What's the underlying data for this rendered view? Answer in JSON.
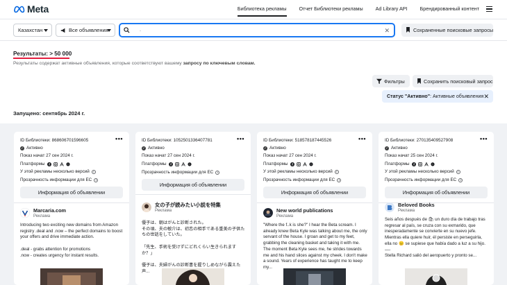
{
  "nav": {
    "logo_text": "Meta",
    "links": [
      {
        "label": "Библиотека рекламы",
        "active": true
      },
      {
        "label": "Отчет Библиотеки рекламы",
        "active": false
      },
      {
        "label": "Ad Library API",
        "active": false
      },
      {
        "label": "Брендированный контент",
        "active": false
      }
    ]
  },
  "filters": {
    "country": "Казахстан",
    "ad_type": "Все объявления",
    "search_value": ".",
    "saved_searches_label": "Сохраненные поисковые запросы"
  },
  "results": {
    "title": "Результаты: > 50 000",
    "subtitle_prefix": "Результаты содержат активные объявления, которые соответствуют вашему",
    "subtitle_bold": "запросу по ключевым словам.",
    "filters_button": "Фильтры",
    "save_search_button": "Сохранить поисковый запрос",
    "chip_bold": "Статус \"Активно\"",
    "chip_rest": ": Активные объявления"
  },
  "launched_label": "Запущено: сентябрь 2024 г.",
  "colors": {
    "accent_blue": "#1877f2",
    "results_underline": "#e41e3f",
    "chip_bg": "#e7f0fd",
    "cards_bg": "#f0f2f5"
  },
  "cards": [
    {
      "library_id": "ID Библиотеки: 868606701596605",
      "status": "Активно",
      "started": "Показ начат 27 сен 2024 г.",
      "platforms_label": "Платформы",
      "versions_label": "У этой рекламы несколько версий",
      "transparency_label": "Прозрачность информации для ЕС",
      "info_button": "Информация об объявлении",
      "advertiser": "Marcaria.com",
      "sponsored": "Реклама",
      "body": "Introducing two exciting new domains from Amazon registry .deal and .now – the perfect domains to boost your offers and drive immediate action.\n\n.deal - grabs attention for promotions\n.now - creates urgency for instant results."
    },
    {
      "library_id": "ID Библиотеки: 1052501336407781",
      "status": "Активно",
      "started": "Показ начат 27 сен 2024 г.",
      "platforms_label": "Платформы",
      "transparency_label": "Прозрачность информации для ЕС",
      "info_button": "Информация об объявлении",
      "advertiser": "女の子が読みたい小説を特集",
      "sponsored": "Реклама",
      "body": "優子は、朝はがんと診断された。\nその頃、夫の敏介は、初恋の相手である重美の子供たちの世話をしていた。\n\n「先生、手術を受けずにどれくらい生きられますか？」\n\n優子は、夫婦がんの診断書を握りしめながら震えた声..."
    },
    {
      "library_id": "ID Библиотеки: 518578187445526",
      "status": "Активно",
      "started": "Показ начат 27 сен 2024 г.",
      "platforms_label": "Платформы",
      "versions_label": "У этой рекламы несколько версий",
      "transparency_label": "Прозрачность информации для ЕС",
      "info_button": "Информация об объявлении",
      "advertiser": "New world publications",
      "sponsored": "Реклама",
      "body": "\"Where the f..k is she?\" I hear the Beta scream. I already knew Beta Kyle was talking about me, the only servant of the house. I groan and get to my feet, grabbing the cleaning basket and taking it with me.\nThe moment Beta Kyle sees me, he strides towards me and his hand slices against my cheek. I don't make a sound. Years of experience has taught me to keep my..."
    },
    {
      "library_id": "ID Библиотеки: 270135409527908",
      "status": "Активно",
      "started": "Показ начат 25 сен 2024 г.",
      "platforms_label": "Платформы",
      "versions_label": "У этой рекламы несколько версий",
      "transparency_label": "Прозрачность информации для ЕС",
      "info_button": "Информация об объявлении",
      "advertiser": "Beloved Books",
      "sponsored": "Реклама",
      "body": "Seis años después de 🛍 un duro día de trabajo tras regresar al país, se cruza con su exmarido, que inesperadamente se convierte en su nuevo jefe.\nMientras ella quiere huir, él persiste en perseguirla, ella no 😐 se supiese que había dado a luz a su hijo.\n—-\nStella Richard salió del aeropuerto y pronto se..."
    }
  ]
}
